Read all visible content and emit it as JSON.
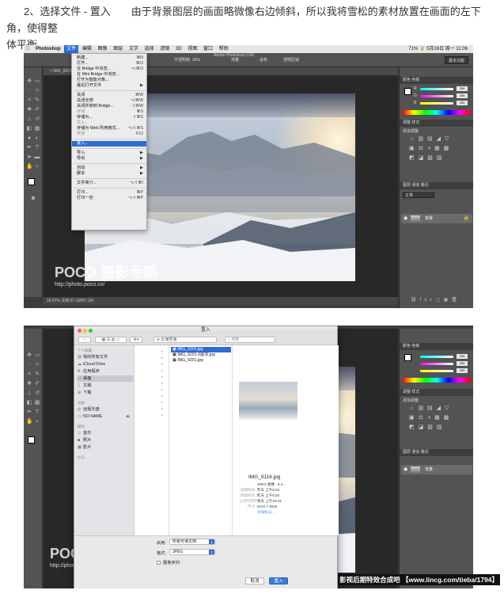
{
  "article": {
    "line1": "2、选择文件 - 置入　　由于背景图层的画面略微像右边倾斜，所以我将雪松的素材放置在画面的左下角，使得整",
    "line2": "体平衡。"
  },
  "screenshot1": {
    "mac_menu": [
      "Photoshop",
      "文件",
      "编辑",
      "图像",
      "图层",
      "文字",
      "选择",
      "滤镜",
      "3D",
      "视图",
      "窗口",
      "帮助"
    ],
    "mac_status": "71%  🔋  5月16日 周一 11:06",
    "window_title": "Adobe Photoshop CS6",
    "options_bar": [
      "不透明度: 16%",
      "流量",
      "设色",
      "透明区域"
    ],
    "workspace": "基本功能",
    "status_bar": "16.67%        文档:57.1M/57.1M",
    "file_menu": [
      {
        "label": "新建...",
        "shortcut": "⌘N"
      },
      {
        "label": "打开...",
        "shortcut": "⌘O"
      },
      {
        "label": "在 Bridge 中浏览...",
        "shortcut": "⌥⌘O"
      },
      {
        "label": "在 Mini Bridge 中浏览...",
        "shortcut": ""
      },
      {
        "label": "打开为智能对象...",
        "shortcut": ""
      },
      {
        "label": "最近打开文件",
        "shortcut": "▶"
      },
      {
        "label": "关闭",
        "shortcut": "⌘W"
      },
      {
        "label": "关闭全部",
        "shortcut": "⌥⌘W"
      },
      {
        "label": "关闭并转到 Bridge...",
        "shortcut": "⇧⌘W"
      },
      {
        "label": "存储",
        "shortcut": "⌘S"
      },
      {
        "label": "存储为...",
        "shortcut": "⇧⌘S"
      },
      {
        "label": "签入...",
        "shortcut": ""
      },
      {
        "label": "存储为 Web 所用格式...",
        "shortcut": "⌥⇧⌘S"
      },
      {
        "label": "恢复",
        "shortcut": "F12"
      },
      {
        "label": "置入...",
        "shortcut": ""
      },
      {
        "label": "导入",
        "shortcut": "▶"
      },
      {
        "label": "导出",
        "shortcut": "▶"
      },
      {
        "label": "自动",
        "shortcut": "▶"
      },
      {
        "label": "脚本",
        "shortcut": "▶"
      },
      {
        "label": "文件简介...",
        "shortcut": "⌥⇧⌘I"
      },
      {
        "label": "打印...",
        "shortcut": "⌘P"
      },
      {
        "label": "打印一份",
        "shortcut": "⌥⇧⌘P"
      }
    ],
    "panel_tabs": {
      "color": "颜色  色板",
      "adjust": "调整  样式",
      "layers": "图层  通道  路径"
    },
    "color_values": [
      "255",
      "255",
      "255"
    ],
    "adjust_label": "添加调整",
    "layer_name": "背景",
    "blend_mode": "正常",
    "watermark_logo": "POCO 摄影专题",
    "watermark_url": "http://photo.poco.cn/"
  },
  "screenshot2": {
    "dialog_title": "置入",
    "location": "云海雪海",
    "search_placeholder": "搜索",
    "sidebar": {
      "favorites_header": "个人收藏",
      "favorites": [
        "我的所有文件",
        "iCloud Drive",
        "应用程序",
        "桌面",
        "文稿",
        "下载"
      ],
      "devices_header": "设备",
      "devices": [
        "远程光盘",
        "NO NAME"
      ],
      "media_header": "媒体",
      "media": [
        "音乐",
        "照片",
        "影片"
      ],
      "tags_header": "标记"
    },
    "files": [
      "IMG_9116.jpg",
      "IMG_9201-2副本.jpg",
      "IMG_9201.jpg"
    ],
    "preview": {
      "name": "IMG_9116.jpg",
      "rows": [
        {
          "k": "",
          "v": "JPEG 图像 - 9.4..."
        },
        {
          "k": "创建时间",
          "v": "昨天 上午9:20"
        },
        {
          "k": "修改时间",
          "v": "昨天 上午9:20"
        },
        {
          "k": "上次打开时间",
          "v": "今天 上午10:23"
        },
        {
          "k": "尺寸",
          "v": "5472 × 3648"
        },
        {
          "k": "",
          "v": "添加标记..."
        }
      ]
    },
    "enable_label": "启用:",
    "enable_value": "所有可读文档",
    "format_label": "格式:",
    "format_value": "JPEG",
    "sequence_label": "图像序列",
    "cancel": "取消",
    "place": "置入"
  },
  "credit": "影视后期特效合成吧 【www.lincg.com/tieba/1794】"
}
